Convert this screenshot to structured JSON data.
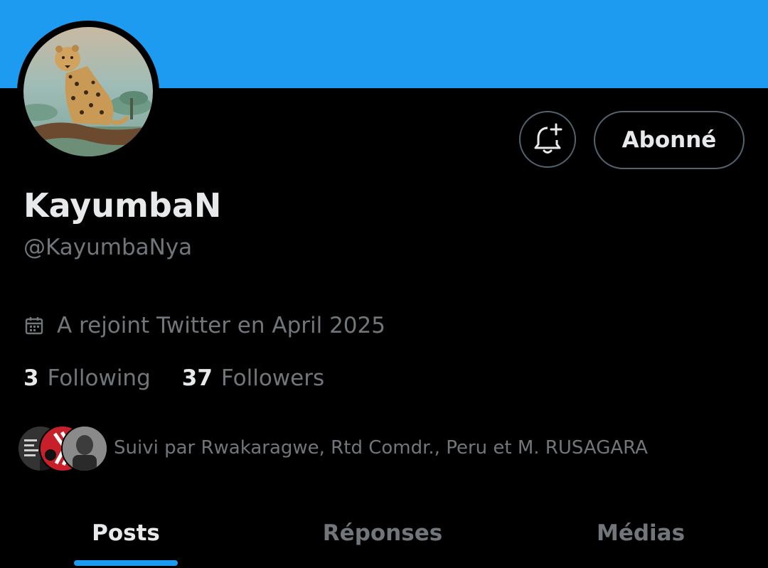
{
  "profile": {
    "display_name": "KayumbaN",
    "handle": "@KayumbaNya",
    "joined": "A rejoint Twitter en April 2025"
  },
  "actions": {
    "notify_icon": "bell-plus-icon",
    "follow_label": "Abonné"
  },
  "stats": {
    "following_count": "3",
    "following_label": "Following",
    "followers_count": "37",
    "followers_label": "Followers"
  },
  "followed_by": {
    "text": "Suivi par Rwakaragwe, Rtd Comdr., Peru et M. RUSAGARA"
  },
  "tabs": [
    {
      "label": "Posts",
      "active": true
    },
    {
      "label": "Réponses",
      "active": false
    },
    {
      "label": "Médias",
      "active": false
    }
  ],
  "colors": {
    "accent": "#1d9bf0",
    "background": "#000000",
    "text_primary": "#e7e9ea",
    "text_secondary": "#71767b"
  }
}
